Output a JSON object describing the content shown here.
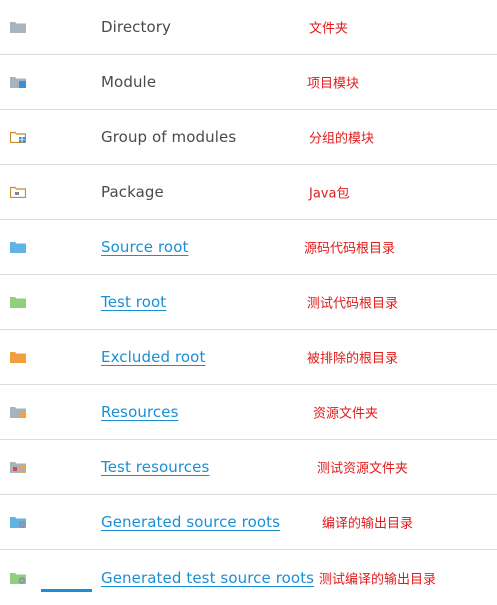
{
  "colors": {
    "label": "#4a4a4a",
    "link": "#1a8fd6",
    "note": "#e01b1b",
    "divider": "#dcdcdc"
  },
  "rows": [
    {
      "icon": "directory-icon",
      "label": "Directory",
      "link": false,
      "note": "文件夹"
    },
    {
      "icon": "module-icon",
      "label": "Module",
      "link": false,
      "note": "项目模块"
    },
    {
      "icon": "group-of-modules-icon",
      "label": "Group of modules",
      "link": false,
      "note": "分组的模块"
    },
    {
      "icon": "package-icon",
      "label": "Package",
      "link": false,
      "note": "Java包"
    },
    {
      "icon": "source-root-icon",
      "label": "Source root",
      "link": true,
      "note": "源码代码根目录"
    },
    {
      "icon": "test-root-icon",
      "label": "Test root",
      "link": true,
      "note": "测试代码根目录"
    },
    {
      "icon": "excluded-root-icon",
      "label": "Excluded root",
      "link": true,
      "note": "被排除的根目录"
    },
    {
      "icon": "resources-icon",
      "label": "Resources",
      "link": true,
      "note": "资源文件夹"
    },
    {
      "icon": "test-resources-icon",
      "label": "Test resources",
      "link": true,
      "note": "测试资源文件夹"
    },
    {
      "icon": "generated-source-roots-icon",
      "label": "Generated source roots",
      "link": true,
      "note": "编译的输出目录"
    },
    {
      "icon": "generated-test-source-roots-icon",
      "label": "Generated test source roots",
      "link": true,
      "note": "测试编译的输出目录"
    }
  ]
}
